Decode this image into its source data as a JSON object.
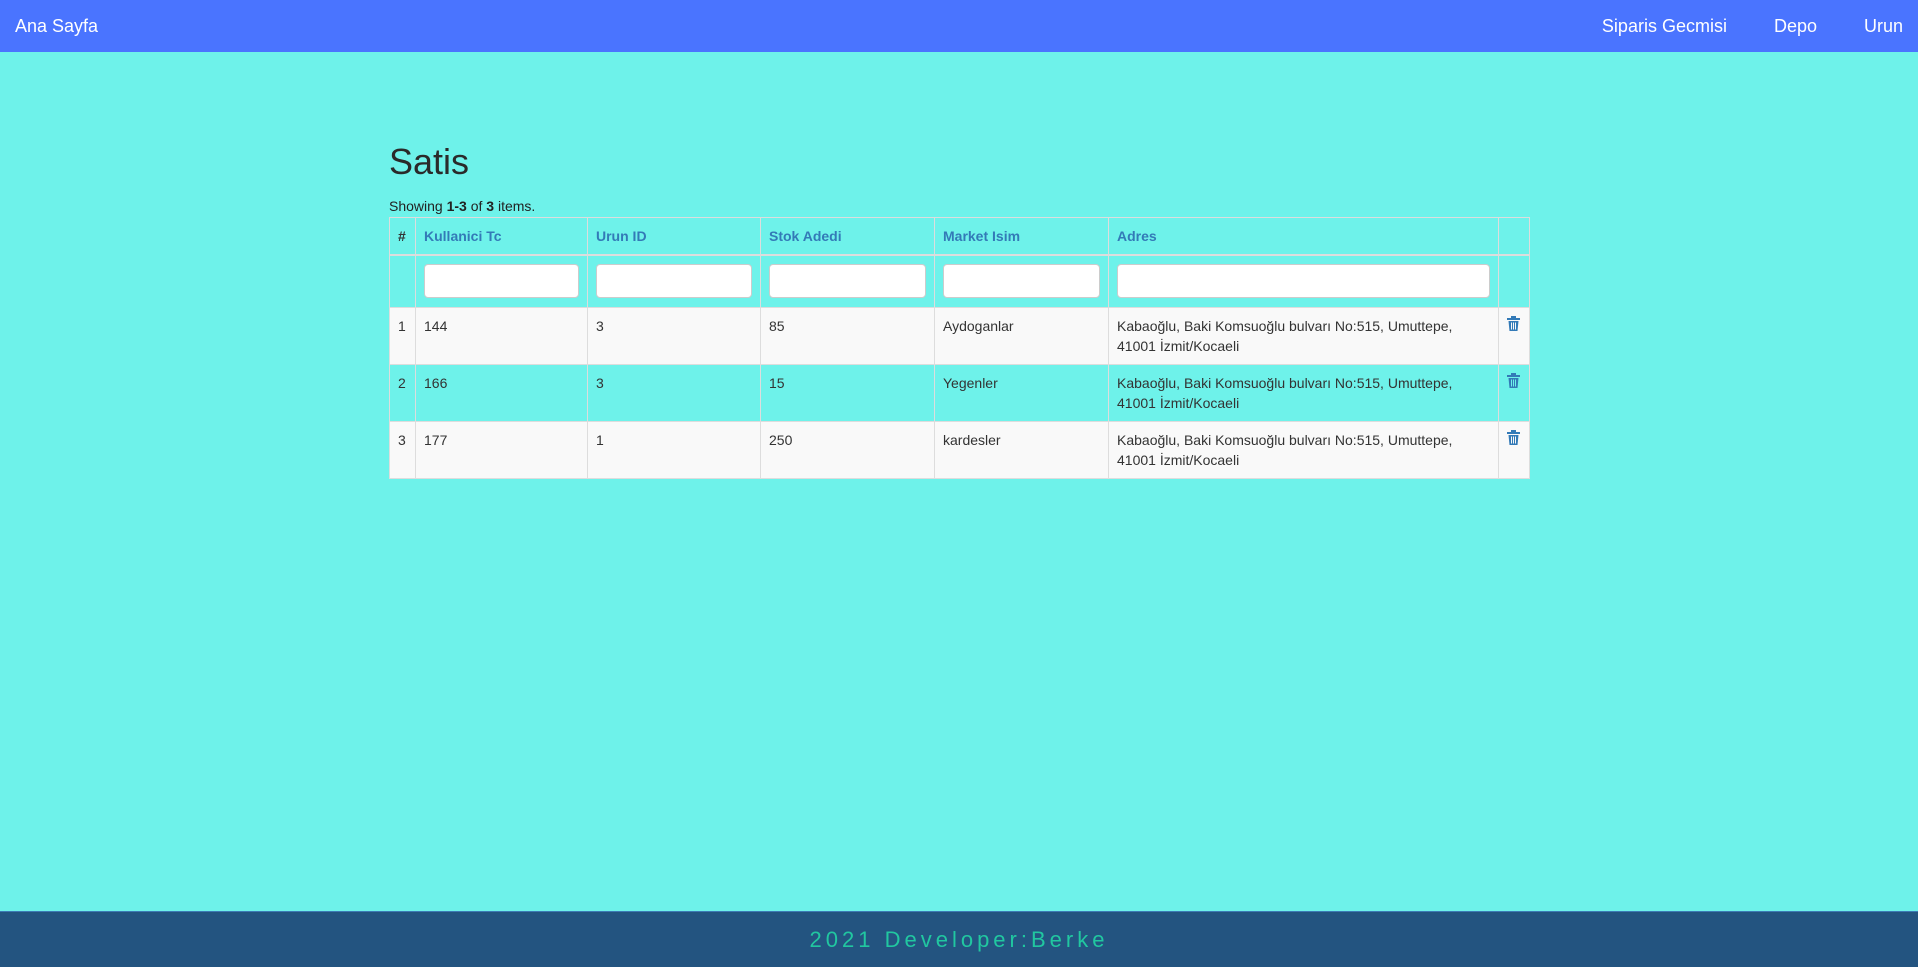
{
  "navbar": {
    "brand": "Ana Sayfa",
    "links": [
      "Siparis Gecmisi",
      "Depo",
      "Urun"
    ],
    "color": "#4a74ff"
  },
  "page": {
    "title": "Satis",
    "summary_prefix": "Showing ",
    "summary_range": "1-3",
    "summary_of": " of ",
    "summary_total": "3",
    "summary_suffix": " items."
  },
  "table": {
    "columns": [
      "#",
      "Kullanici Tc",
      "Urun ID",
      "Stok Adedi",
      "Market Isim",
      "Adres"
    ],
    "filters": [
      "",
      "",
      "",
      "",
      ""
    ],
    "rows": [
      {
        "num": "1",
        "tc": "144",
        "urun_id": "3",
        "stok": "85",
        "market": "Aydoganlar",
        "adres": "Kabaoğlu, Baki Komsuoğlu bulvarı No:515, Umuttepe, 41001 İzmit/Kocaeli",
        "action_icon": "trash-icon"
      },
      {
        "num": "2",
        "tc": "166",
        "urun_id": "3",
        "stok": "15",
        "market": "Yegenler",
        "adres": "Kabaoğlu, Baki Komsuoğlu bulvarı No:515, Umuttepe, 41001 İzmit/Kocaeli",
        "action_icon": "trash-icon"
      },
      {
        "num": "3",
        "tc": "177",
        "urun_id": "1",
        "stok": "250",
        "market": "kardesler",
        "adres": "Kabaoğlu, Baki Komsuoğlu bulvarı No:515, Umuttepe, 41001 İzmit/Kocaeli",
        "action_icon": "trash-icon"
      }
    ]
  },
  "footer": {
    "text": "2021 Developer:Berke",
    "background": "#235480",
    "text_color": "#21c7a0"
  },
  "colors": {
    "page_background": "#6ef2ea",
    "link": "#337ab7"
  }
}
